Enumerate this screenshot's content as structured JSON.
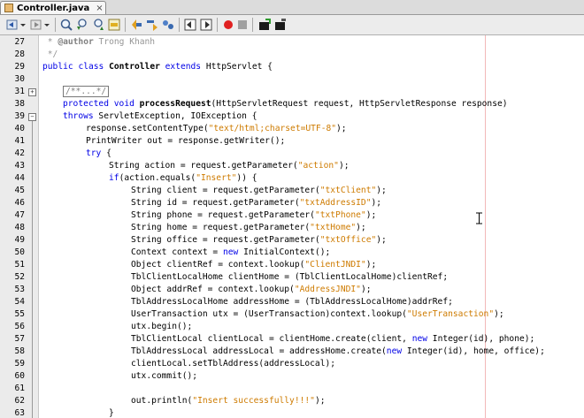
{
  "tab": {
    "label": "Controller.java",
    "close": "×"
  },
  "toolbar": {
    "buttons": [
      "back-icon",
      "dropdown-icon",
      "forward-icon",
      "dropdown-icon",
      "find-icon",
      "find-previous-icon",
      "find-next-icon",
      "toggle-highlight-icon",
      "shift-left-icon",
      "shift-right-icon",
      "bookmark-icon",
      "previous-bookmark-icon",
      "next-bookmark-icon",
      "start-macro-icon",
      "stop-macro-icon",
      "comment-icon",
      "uncomment-icon"
    ]
  },
  "gutter": {
    "line_numbers": [
      "27",
      "28",
      "29",
      "30",
      "31",
      "38",
      "39",
      "40",
      "41",
      "42",
      "43",
      "44",
      "45",
      "46",
      "47",
      "48",
      "49",
      "50",
      "51",
      "52",
      "53",
      "54",
      "55",
      "56",
      "57",
      "58",
      "59",
      "60",
      "61",
      "62",
      "63"
    ],
    "fold_expand": "+",
    "fold_collapse": "−"
  },
  "code": {
    "l27": {
      "star": " * ",
      "tag": "@author",
      "rest": " Trong Khanh"
    },
    "l28": " */",
    "l29": {
      "kw1": "public",
      "sp1": " ",
      "kw2": "class",
      "sp2": " ",
      "name": "Controller",
      "sp3": " ",
      "kw3": "extends",
      "rest": " HttpServlet {"
    },
    "l31": "/**...*/",
    "l38": {
      "kw1": "protected",
      "sp1": " ",
      "kw2": "void",
      "sp2": " ",
      "name": "processRequest",
      "rest": "(HttpServletRequest request, HttpServletResponse response)"
    },
    "l39": {
      "kw": "throws",
      "rest": " ServletException, IOException {"
    },
    "l40": {
      "pre": "response.setContentType(",
      "str": "\"text/html;charset=UTF-8\"",
      "post": ");"
    },
    "l41": "PrintWriter out = response.getWriter();",
    "l42": {
      "kw": "try",
      "rest": " {"
    },
    "l43": {
      "pre": "String action = request.getParameter(",
      "str": "\"action\"",
      "post": ");"
    },
    "l44": {
      "kw": "if",
      "pre": "(action.equals(",
      "str": "\"Insert\"",
      "post": ")) {"
    },
    "l45": {
      "pre": "String client = request.getParameter(",
      "str": "\"txtClient\"",
      "post": ");"
    },
    "l46": {
      "pre": "String id = request.getParameter(",
      "str": "\"txtAddressID\"",
      "post": ");"
    },
    "l47": {
      "pre": "String phone = request.getParameter(",
      "str": "\"txtPhone\"",
      "post": ");"
    },
    "l48": {
      "pre": "String home = request.getParameter(",
      "str": "\"txtHome\"",
      "post": ");"
    },
    "l49": {
      "pre": "String office = request.getParameter(",
      "str": "\"txtOffice\"",
      "post": ");"
    },
    "l50": {
      "pre": "Context context = ",
      "kw": "new",
      "post": " InitialContext();"
    },
    "l51": {
      "pre": "Object clientRef = context.lookup(",
      "str": "\"ClientJNDI\"",
      "post": ");"
    },
    "l52": "TblClientLocalHome clientHome = (TblClientLocalHome)clientRef;",
    "l53": {
      "pre": "Object addrRef = context.lookup(",
      "str": "\"AddressJNDI\"",
      "post": ");"
    },
    "l54": "TblAddressLocalHome addressHome = (TblAddressLocalHome)addrRef;",
    "l55": {
      "pre": "UserTransaction utx = (UserTransaction)context.lookup(",
      "str": "\"UserTransaction\"",
      "post": ");"
    },
    "l56": "utx.begin();",
    "l57": {
      "pre": "TblClientLocal clientLocal = clientHome.create(client, ",
      "kw": "new",
      "post": " Integer(id), phone);"
    },
    "l58": {
      "pre": "TblAddressLocal addressLocal = addressHome.create(",
      "kw": "new",
      "post": " Integer(id), home, office);"
    },
    "l59": "clientLocal.setTblAddress(addressLocal);",
    "l60": "utx.commit();",
    "l62": {
      "pre": "out.println(",
      "str": "\"Insert successfully!!!\"",
      "post": ");"
    },
    "l63": "}"
  }
}
